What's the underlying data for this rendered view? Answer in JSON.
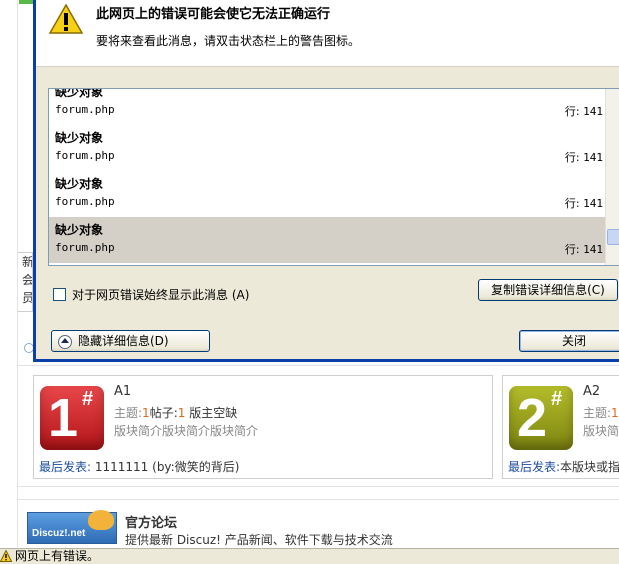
{
  "dialog": {
    "title": "此网页上的错误可能会使它无法正确运行",
    "subtitle": "要将来查看此消息，请双击状态栏上的警告图标。",
    "errors": [
      {
        "name": "缺少对象",
        "file": "forum.php",
        "line_label": "行:",
        "line": "141"
      },
      {
        "name": "缺少对象",
        "file": "forum.php",
        "line_label": "行:",
        "line": "141"
      },
      {
        "name": "缺少对象",
        "file": "forum.php",
        "line_label": "行:",
        "line": "141"
      },
      {
        "name": "缺少对象",
        "file": "forum.php",
        "line_label": "行:",
        "line": "141"
      }
    ],
    "selected_error_index": 3,
    "always_show_label": "对于网页错误始终显示此消息 (A)",
    "always_show_checked": false,
    "copy_button": "复制错误详细信息(C)",
    "hide_details_button": "隐藏详细信息(D)",
    "close_button": "关闭"
  },
  "page": {
    "side_peek": [
      "新",
      "会",
      "员"
    ],
    "forums": [
      {
        "badge": "1",
        "badge_mark": "#",
        "badge_color": "#c8191d",
        "name": "A1",
        "stats_topic_label": "主题:",
        "stats_topic": "1",
        "stats_post_label": "帖子:",
        "stats_post": "1",
        "stats_moderator": "版主空缺",
        "description": "版块简介版块简介版块简介",
        "last_label": "最后发表:",
        "last_value": "1111111 (by:微笑的背后)"
      },
      {
        "badge": "2",
        "badge_mark": "#",
        "badge_color": "#8f9a18",
        "name": "A2",
        "stats_topic_label": "主题:",
        "stats_topic": "1",
        "stats_post_label": "",
        "stats_post": "",
        "stats_moderator": "",
        "description": "版块简",
        "last_label": "最后发表:",
        "last_value": "本版块或指"
      }
    ],
    "official": {
      "logo_text": "Discuz!.net",
      "title": "官方论坛",
      "description": "提供最新 Discuz! 产品新闻、软件下载与技术交流"
    }
  },
  "statusbar": {
    "text": "网页上有错误。"
  },
  "colors": {
    "dialog_border": "#0a3fa8",
    "dialog_bg": "#ece9d8",
    "stat_value": "#e06a1b",
    "last_post_label": "#1e4ea0"
  }
}
